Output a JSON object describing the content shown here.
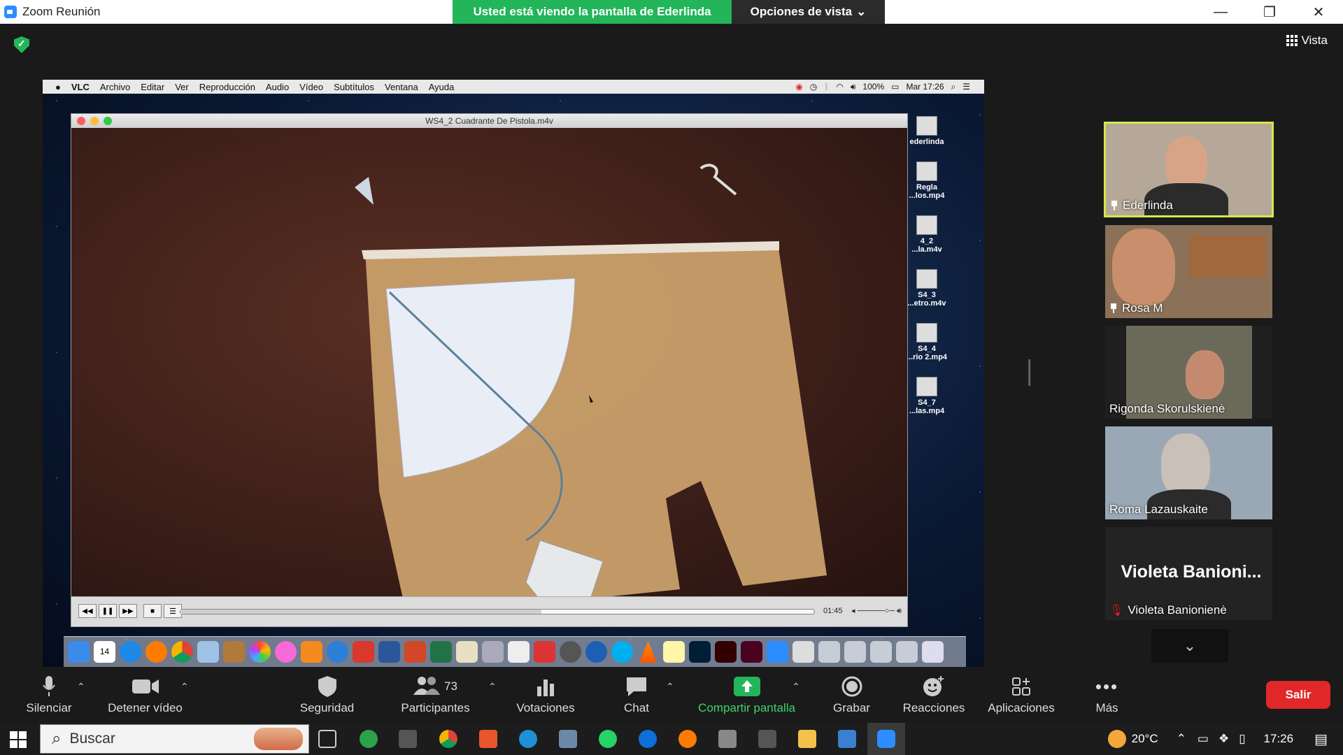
{
  "window": {
    "title": "Zoom Reunión",
    "share_banner": "Usted está viendo la pantalla de Ederlinda",
    "view_options": "Opciones de vista",
    "view_button": "Vista"
  },
  "mac": {
    "menu": [
      "VLC",
      "Archivo",
      "Editar",
      "Ver",
      "Reproducción",
      "Audio",
      "Vídeo",
      "Subtítulos",
      "Ventana",
      "Ayuda"
    ],
    "battery": "100%",
    "clock": "Mar 17:26",
    "vlc_title": "WS4_2 Cuadrante De Pistola.m4v",
    "vlc_time": "01:45",
    "vlc_progress": 0.57,
    "desktop_files": [
      "ederlinda",
      "Regla\n...los.mp4",
      "4_2\n...la.m4v",
      "S4_3\n...etro.m4v",
      "S4_4\n...rio 2.mp4",
      "S4_7\n...las.mp4"
    ],
    "dock_calendar_day": "14"
  },
  "participants": [
    {
      "name": "Ederlinda",
      "pinned": true,
      "muted": false,
      "active": true
    },
    {
      "name": "Rosa M",
      "pinned": true,
      "muted": false,
      "active": false
    },
    {
      "name": "Rigonda Skorulskienė",
      "pinned": false,
      "muted": false,
      "active": false
    },
    {
      "name": "Roma Lazauskaite",
      "pinned": false,
      "muted": false,
      "active": false
    },
    {
      "name": "Violeta Banionienė",
      "display_big": "Violeta Banioni...",
      "pinned": false,
      "muted": true,
      "active": false
    }
  ],
  "toolbar": {
    "mute": "Silenciar",
    "stop_video": "Detener vídeo",
    "security": "Seguridad",
    "participants": "Participantes",
    "participants_count": "73",
    "polls": "Votaciones",
    "chat": "Chat",
    "share": "Compartir pantalla",
    "record": "Grabar",
    "reactions": "Reacciones",
    "apps": "Aplicaciones",
    "more": "Más",
    "leave": "Salir"
  },
  "taskbar": {
    "search_placeholder": "Buscar",
    "weather": "20°C",
    "time": "17:26"
  },
  "colors": {
    "green": "#23b55a",
    "zoom_blue": "#2d8cff",
    "leave_red": "#e02828",
    "active_border": "#d4e84a"
  }
}
